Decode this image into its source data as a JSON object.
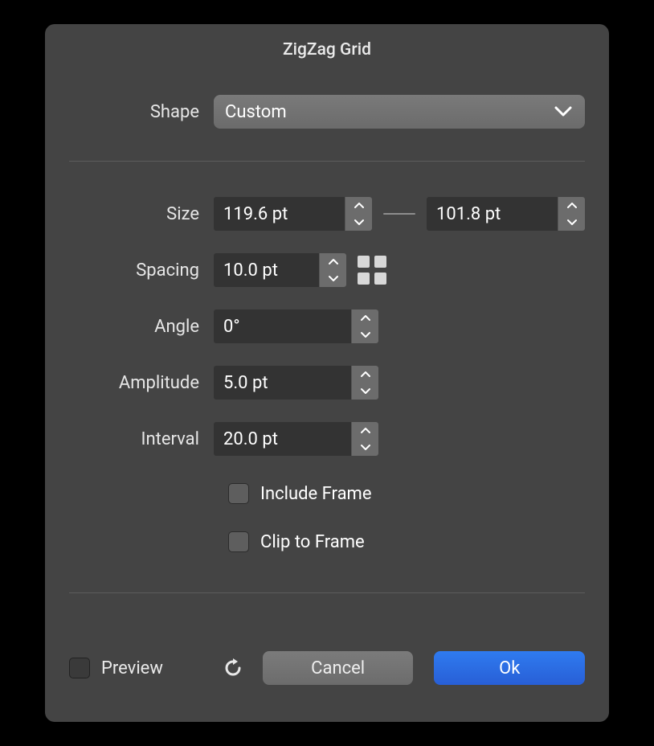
{
  "title": "ZigZag Grid",
  "shape": {
    "label": "Shape",
    "value": "Custom"
  },
  "size": {
    "label": "Size",
    "w": "119.6 pt",
    "h": "101.8 pt"
  },
  "spacing": {
    "label": "Spacing",
    "value": "10.0 pt"
  },
  "angle": {
    "label": "Angle",
    "value": "0°"
  },
  "amplitude": {
    "label": "Amplitude",
    "value": "5.0 pt"
  },
  "interval": {
    "label": "Interval",
    "value": "20.0 pt"
  },
  "include_frame": {
    "label": "Include Frame",
    "checked": false
  },
  "clip_to_frame": {
    "label": "Clip to Frame",
    "checked": false
  },
  "preview": {
    "label": "Preview",
    "checked": false
  },
  "buttons": {
    "cancel": "Cancel",
    "ok": "Ok"
  }
}
